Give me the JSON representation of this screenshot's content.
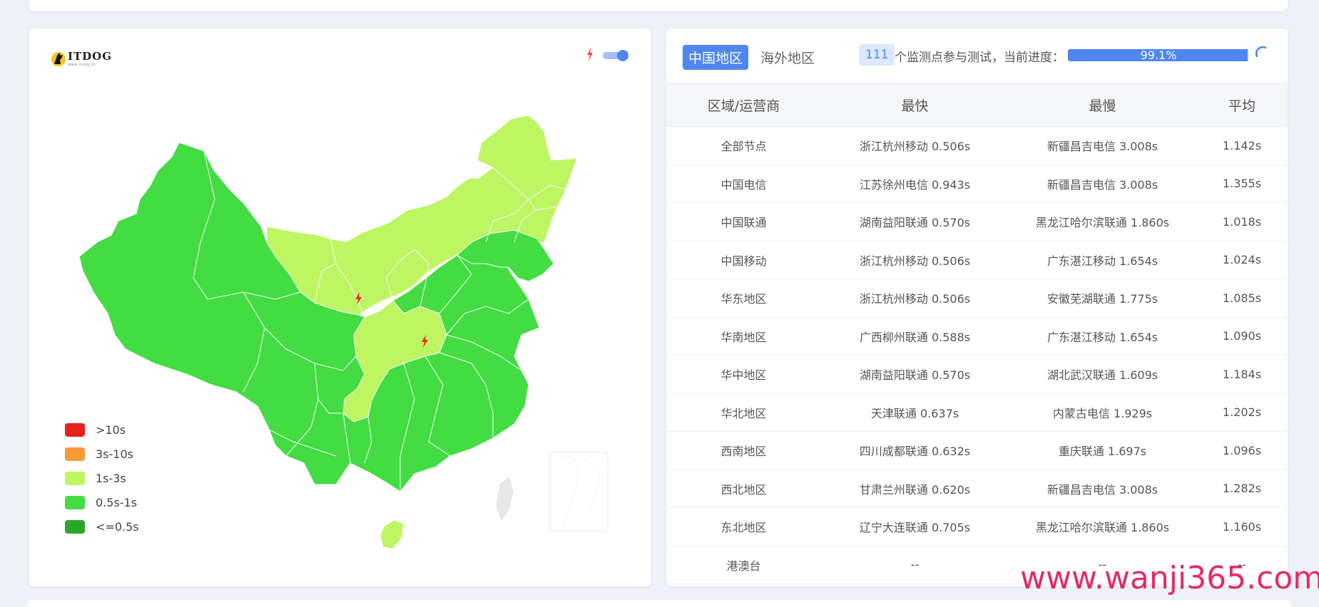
{
  "colors": {
    "gt10s": "#e5231b",
    "s3_10": "#f99a38",
    "s1_3": "#bef562",
    "s05_1": "#43dc42",
    "lt05": "#29a828",
    "accent": "#4f86f0"
  },
  "map_card": {
    "logo": {
      "name": "ITDOG",
      "sub": "www.itdog.cn"
    },
    "toggle_on": true,
    "legend": [
      {
        "label": ">10s",
        "color_key": "gt10s"
      },
      {
        "label": "3s-10s",
        "color_key": "s3_10"
      },
      {
        "label": "1s-3s",
        "color_key": "s1_3"
      },
      {
        "label": "0.5s-1s",
        "color_key": "s05_1"
      },
      {
        "label": "<=0.5s",
        "color_key": "lt05"
      }
    ]
  },
  "results": {
    "tabs": [
      {
        "label": "中国地区",
        "active": true
      },
      {
        "label": "海外地区",
        "active": false
      }
    ],
    "count": "111",
    "progress_text": "个监测点参与测试，当前进度：",
    "progress_percent": 99.1,
    "progress_label": "99.1%",
    "columns": [
      "区域/运营商",
      "最快",
      "最慢",
      "平均"
    ],
    "rows": [
      [
        "全部节点",
        "浙江杭州移动 0.506s",
        "新疆昌吉电信 3.008s",
        "1.142s"
      ],
      [
        "中国电信",
        "江苏徐州电信 0.943s",
        "新疆昌吉电信 3.008s",
        "1.355s"
      ],
      [
        "中国联通",
        "湖南益阳联通 0.570s",
        "黑龙江哈尔滨联通 1.860s",
        "1.018s"
      ],
      [
        "中国移动",
        "浙江杭州移动 0.506s",
        "广东湛江移动 1.654s",
        "1.024s"
      ],
      [
        "华东地区",
        "浙江杭州移动 0.506s",
        "安徽芜湖联通 1.775s",
        "1.085s"
      ],
      [
        "华南地区",
        "广西柳州联通 0.588s",
        "广东湛江移动 1.654s",
        "1.090s"
      ],
      [
        "华中地区",
        "湖南益阳联通 0.570s",
        "湖北武汉联通 1.609s",
        "1.184s"
      ],
      [
        "华北地区",
        "天津联通 0.637s",
        "内蒙古电信 1.929s",
        "1.202s"
      ],
      [
        "西南地区",
        "四川成都联通 0.632s",
        "重庆联通 1.697s",
        "1.096s"
      ],
      [
        "西北地区",
        "甘肃兰州联通 0.620s",
        "新疆昌吉电信 3.008s",
        "1.282s"
      ],
      [
        "东北地区",
        "辽宁大连联通 0.705s",
        "黑龙江哈尔滨联通 1.860s",
        "1.160s"
      ],
      [
        "港澳台",
        "--",
        "--",
        "--"
      ]
    ]
  },
  "watermark": "www.wanji365.com"
}
